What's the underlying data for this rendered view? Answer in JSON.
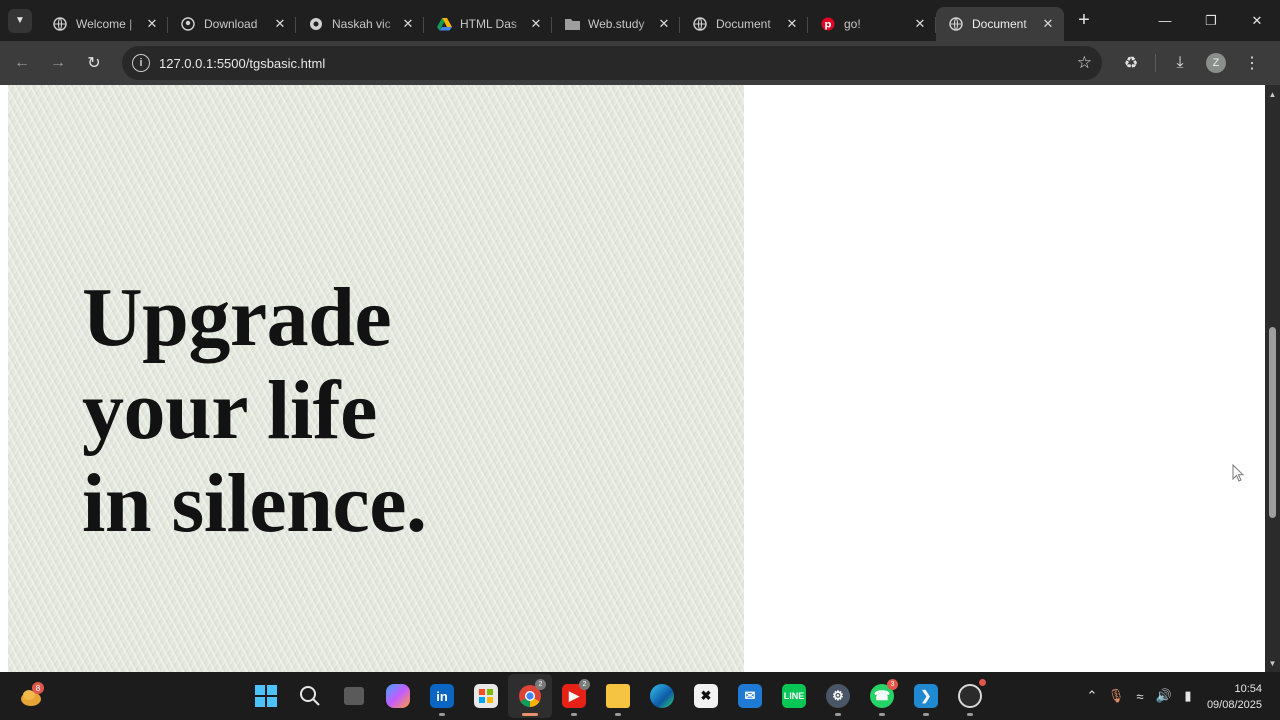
{
  "browser": {
    "tabs": [
      {
        "title": "Welcome |",
        "favicon": "globe-icon"
      },
      {
        "title": "Download",
        "favicon": "github-icon"
      },
      {
        "title": "Naskah vic",
        "favicon": "web-icon"
      },
      {
        "title": "HTML Das",
        "favicon": "drive-icon"
      },
      {
        "title": "Web.study",
        "favicon": "folder-icon"
      },
      {
        "title": "Document",
        "favicon": "globe-icon"
      },
      {
        "title": "go!",
        "favicon": "pinterest-icon"
      },
      {
        "title": "Document",
        "favicon": "globe-icon",
        "active": true
      }
    ],
    "url": "127.0.0.1:5500/tgsbasic.html",
    "profile_initial": "Z"
  },
  "page": {
    "headline_line1": "Upgrade",
    "headline_line2": "your life",
    "headline_line3": "in silence.",
    "hero_background": "#e3e8dd",
    "text_color": "#121212"
  },
  "taskbar": {
    "widget_badge": "8",
    "chrome_badge": "2",
    "youtube_badge": "2",
    "whatsapp_badge": "3",
    "time": "10:54",
    "date": "09/08/2025"
  }
}
